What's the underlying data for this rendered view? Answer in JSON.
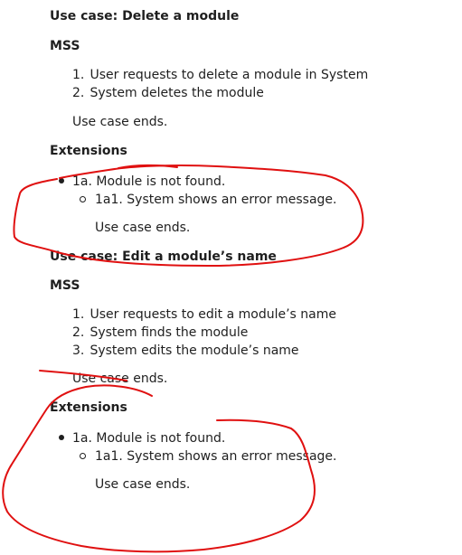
{
  "use_case_1": {
    "title": "Use case: Delete a module",
    "mss_label": "MSS",
    "steps": [
      {
        "num": "1.",
        "text": "User requests to delete a module in System"
      },
      {
        "num": "2.",
        "text": "System deletes the module"
      }
    ],
    "ends": "Use case ends.",
    "extensions_label": "Extensions",
    "extension": "1a. Module is not found.",
    "sub_extension": "1a1. System shows an error message.",
    "sub_ends": "Use case ends."
  },
  "use_case_2": {
    "title": "Use case: Edit a module’s name",
    "mss_label": "MSS",
    "steps": [
      {
        "num": "1.",
        "text": "User requests to edit a module’s name"
      },
      {
        "num": "2.",
        "text": "System finds the module"
      },
      {
        "num": "3.",
        "text": "System edits the module’s name"
      }
    ],
    "ends": "Use case ends.",
    "extensions_label": "Extensions",
    "extension": "1a. Module is not found.",
    "sub_extension": "1a1. System shows an error message.",
    "sub_ends": "Use case ends."
  },
  "annotation_color": "#e01010"
}
